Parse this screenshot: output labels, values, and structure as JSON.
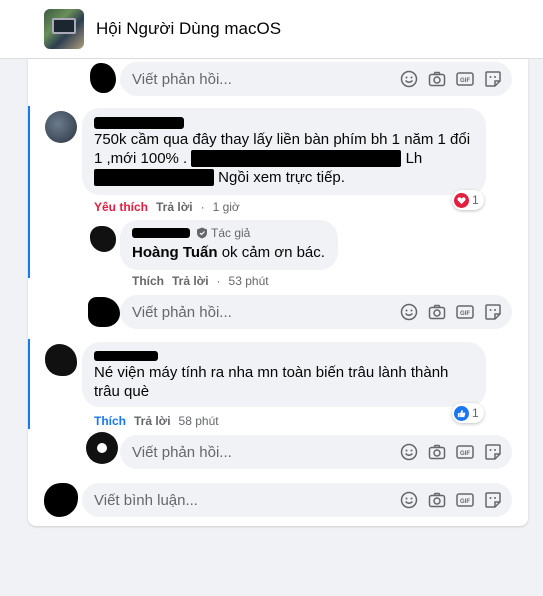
{
  "header": {
    "group_title": "Hội Người Dùng macOS"
  },
  "composer": {
    "reply_placeholder": "Viết phản hồi...",
    "comment_placeholder": "Viết bình luận...",
    "icons": [
      "smiley-icon",
      "camera-icon",
      "gif-icon",
      "sticker-icon"
    ]
  },
  "comments": [
    {
      "text_a": "750k cầm qua đây thay lấy liền bàn phím bh 1 năm 1 đổi 1 ,mới 100% .",
      "text_b": "Lh",
      "text_c": "Ngồi xem trực tiếp.",
      "actions": {
        "like": "Yêu thích",
        "reply": "Trả lời",
        "time": "1 giờ"
      },
      "reaction": {
        "icon": "heart-icon",
        "count": "1"
      },
      "reply": {
        "badge": "Tác giả",
        "mention": "Hoàng Tuấn",
        "text": "ok cảm ơn bác.",
        "actions": {
          "like": "Thích",
          "reply": "Trả lời",
          "time": "53 phút"
        }
      }
    },
    {
      "text": "Né viện máy tính ra nha mn toàn biến trâu lành thành trâu què",
      "actions": {
        "like": "Thích",
        "reply": "Trả lời",
        "time": "58 phút"
      },
      "reaction": {
        "icon": "thumbs-up-icon",
        "count": "1"
      }
    }
  ],
  "colors": {
    "accent": "#1877f2",
    "love": "#e41e3f",
    "text_secondary": "#65676b"
  }
}
